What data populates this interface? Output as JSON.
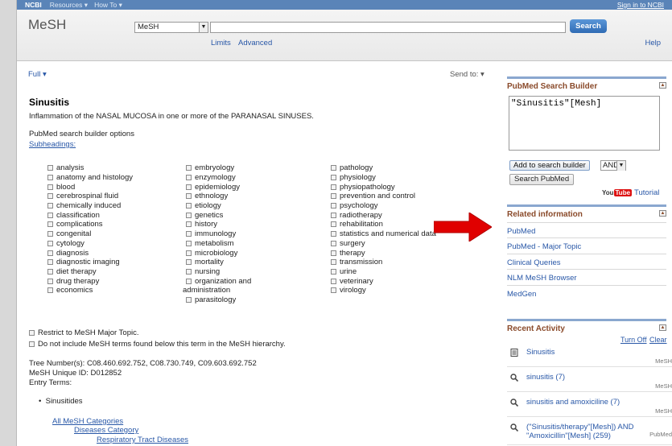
{
  "ncbi": {
    "logo": "NCBI",
    "resources": "Resources",
    "howto": "How To",
    "signin": "Sign in to NCBI"
  },
  "search": {
    "db_title": "MeSH",
    "db_select": "MeSH",
    "query": "",
    "button": "Search",
    "limits": "Limits",
    "advanced": "Advanced",
    "help": "Help"
  },
  "record": {
    "format": "Full",
    "send_to": "Send to:",
    "title": "Sinusitis",
    "scope_note": "Inflammation of the NASAL MUCOSA in one or more of the PARANASAL SINUSES.",
    "builder_options": "PubMed search builder options",
    "subheadings_label": "Subheadings:",
    "subheadings_col1": [
      "analysis",
      "anatomy and histology",
      "blood",
      "cerebrospinal fluid",
      "chemically induced",
      "classification",
      "complications",
      "congenital",
      "cytology",
      "diagnosis",
      "diagnostic imaging",
      "diet therapy",
      "drug therapy",
      "economics"
    ],
    "subheadings_col2": [
      "embryology",
      "enzymology",
      "epidemiology",
      "ethnology",
      "etiology",
      "genetics",
      "history",
      "immunology",
      "metabolism",
      "microbiology",
      "mortality",
      "nursing",
      "organization and",
      "administration",
      "parasitology"
    ],
    "subheadings_col3": [
      "pathology",
      "physiology",
      "physiopathology",
      "prevention and control",
      "psychology",
      "radiotherapy",
      "rehabilitation",
      "statistics and numerical data",
      "surgery",
      "therapy",
      "transmission",
      "urine",
      "veterinary",
      "virology"
    ],
    "restrict_major": "Restrict to MeSH Major Topic.",
    "no_explode": "Do not include MeSH terms found below this term in the MeSH hierarchy.",
    "tree_numbers": "Tree Number(s): C08.460.692.752, C08.730.749, C09.603.692.752",
    "unique_id": "MeSH Unique ID: D012852",
    "entry_terms_label": "Entry Terms:",
    "entry_terms": [
      "Sinusitides"
    ],
    "hierarchy": [
      "All MeSH Categories",
      "Diseases Category",
      "Respiratory Tract Diseases"
    ]
  },
  "sidebar": {
    "builder_title": "PubMed Search Builder",
    "builder_text": "\"Sinusitis\"[Mesh]",
    "add_button": "Add to search builder",
    "operator": "AND",
    "search_pubmed": "Search PubMed",
    "youtube_you": "You",
    "youtube_tube": "Tube",
    "tutorial": "Tutorial",
    "related_title": "Related information",
    "related_links": [
      "PubMed",
      "PubMed - Major Topic",
      "Clinical Queries",
      "NLM MeSH Browser",
      "MedGen"
    ],
    "recent_title": "Recent Activity",
    "turn_off": "Turn Off",
    "clear": "Clear",
    "recent": [
      {
        "text": "Sinusitis",
        "db": "MeSH",
        "icon": "document-icon"
      },
      {
        "text": "sinusitis (7)",
        "db": "MeSH",
        "icon": "search-icon"
      },
      {
        "text": "sinusitis and amoxiciline (7)",
        "db": "MeSH",
        "icon": "search-icon"
      },
      {
        "text": "(\"Sinusitis/therapy\"[Mesh]) AND \"Amoxicillin\"[Mesh] (259)",
        "db": "PubMed",
        "icon": "search-icon"
      }
    ]
  },
  "colors": {
    "annotation_arrow": "#e00000",
    "link": "#2857a7",
    "section_title": "#8a4a2a"
  }
}
